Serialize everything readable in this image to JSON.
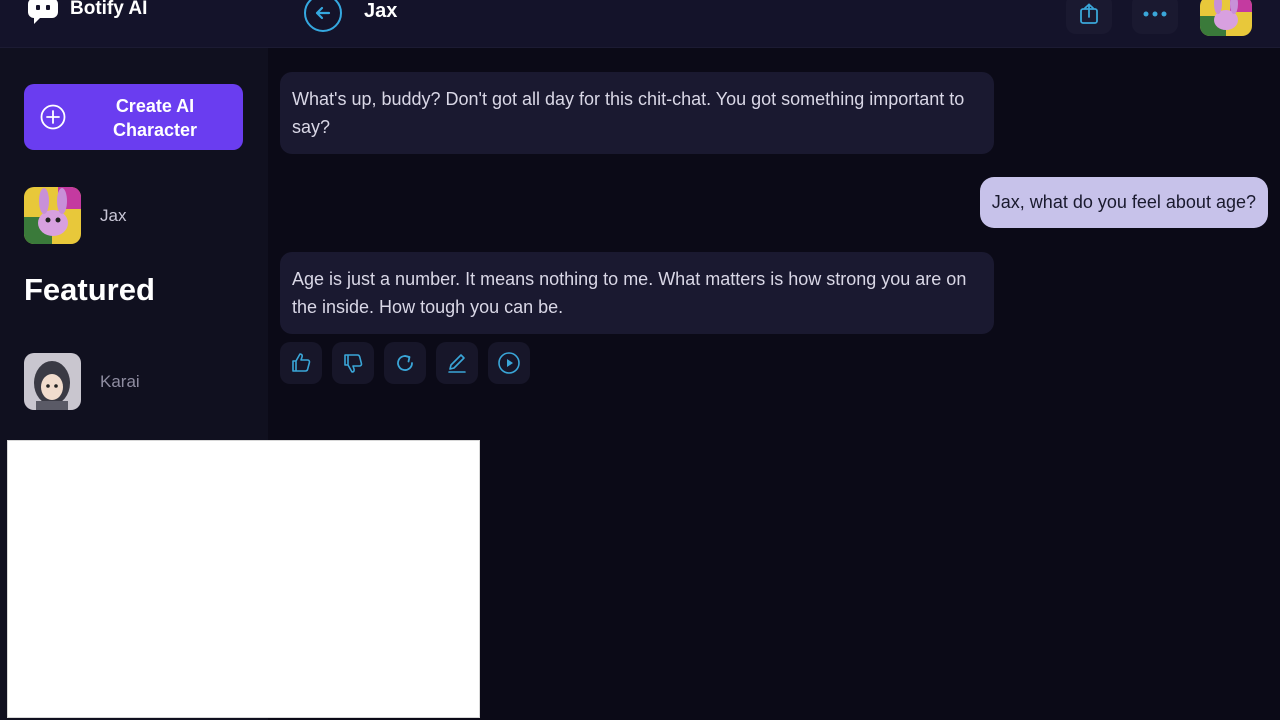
{
  "app": {
    "name": "Botify AI"
  },
  "header": {
    "chat_title": "Jax"
  },
  "sidebar": {
    "create_button": {
      "line1": "Create AI",
      "line2": "Character"
    },
    "recent": [
      {
        "name": "Jax"
      }
    ],
    "featured_heading": "Featured",
    "featured": [
      {
        "name": "Karai"
      }
    ]
  },
  "messages": [
    {
      "role": "bot",
      "text": "What's up, buddy? Don't got all day for this chit-chat. You got something important to say?"
    },
    {
      "role": "user",
      "text": "Jax, what do you feel about age?"
    },
    {
      "role": "bot",
      "text": "Age is just a number. It means nothing to me. What matters is how strong you are on the inside. How tough you can be."
    }
  ],
  "message_actions": [
    "thumbs-up-icon",
    "thumbs-down-icon",
    "regenerate-icon",
    "edit-icon",
    "play-icon"
  ],
  "colors": {
    "background": "#0b0a17",
    "header": "#14132a",
    "sidebar": "#10101f",
    "accent": "#6a3df0",
    "bot_bubble": "#1a1930",
    "user_bubble": "#c7c2ea",
    "icon": "#3aa6d8"
  }
}
